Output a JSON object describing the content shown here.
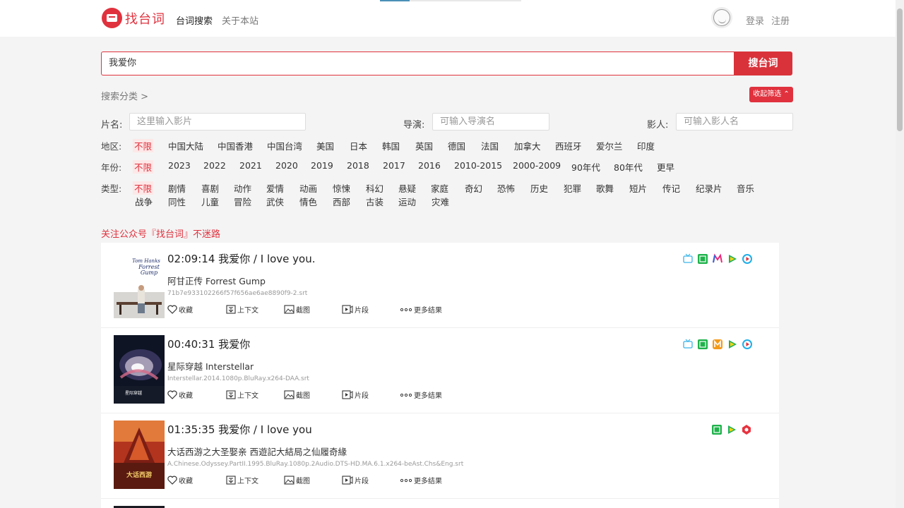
{
  "header": {
    "logo_text": "找台词",
    "nav": [
      "台词搜索",
      "关于本站"
    ],
    "login": "登录",
    "register": "注册"
  },
  "search": {
    "value": "我爱你",
    "button": "搜台词"
  },
  "filters": {
    "category_label": "搜索分类 >",
    "collapse_button": "收起筛选 ⌃",
    "film_label": "片名:",
    "film_placeholder": "这里输入影片",
    "director_label": "导演:",
    "director_placeholder": "可输入导演名",
    "actor_label": "影人:",
    "actor_placeholder": "可输入影人名",
    "region": {
      "label": "地区:",
      "options": [
        "不限",
        "中国大陆",
        "中国香港",
        "中国台湾",
        "美国",
        "日本",
        "韩国",
        "英国",
        "德国",
        "法国",
        "加拿大",
        "西班牙",
        "爱尔兰",
        "印度"
      ]
    },
    "year": {
      "label": "年份:",
      "options": [
        "不限",
        "2023",
        "2022",
        "2021",
        "2020",
        "2019",
        "2018",
        "2017",
        "2016",
        "2010-2015",
        "2000-2009",
        "90年代",
        "80年代",
        "更早"
      ]
    },
    "genre": {
      "label": "类型:",
      "row1": [
        "不限",
        "剧情",
        "喜剧",
        "动作",
        "爱情",
        "动画",
        "惊悚",
        "科幻",
        "悬疑",
        "家庭",
        "奇幻",
        "恐怖",
        "历史",
        "犯罪",
        "歌舞",
        "短片",
        "传记",
        "纪录片",
        "音乐"
      ],
      "row2": [
        "战争",
        "同性",
        "儿童",
        "冒险",
        "武侠",
        "情色",
        "西部",
        "古装",
        "运动",
        "灾难"
      ]
    }
  },
  "follow_text": "关注公众号『找台词』不迷路",
  "actions": {
    "favorite": "收藏",
    "context": "上下文",
    "screenshot": "截图",
    "clip": "片段",
    "more": "更多结果"
  },
  "results": [
    {
      "time": "02:09:14",
      "line": "我爱你 / I love you.",
      "movie": "阿甘正传 Forrest Gump",
      "file": "71b7e933102266f57f656ae6ae8890f9-2.srt",
      "poster_text": "Tom Hanks is Forrest Gump",
      "platforms": [
        "tv-icon",
        "iqiyi-icon",
        "mgtv-icon",
        "tencent-icon",
        "youku-icon"
      ]
    },
    {
      "time": "00:40:31",
      "line": "我爱你",
      "movie": "星际穿越 Interstellar",
      "file": "Interstellar.2014.1080p.BluRay.x264-DAA.srt",
      "poster_text": "星际穿越",
      "platforms": [
        "tv-icon",
        "iqiyi-icon",
        "mgtv-orange-icon",
        "tencent-icon",
        "youku-icon"
      ]
    },
    {
      "time": "01:35:35",
      "line": "我爱你 / I love you",
      "movie": "大话西游之大圣娶亲 西遊記大結局之仙履奇緣",
      "file": "A.Chinese.Odyssey.PartII.1995.BluRay.1080p.2Audio.DTS-HD.MA.6.1.x264-beAst.Chs&Eng.srt",
      "poster_text": "大话西游",
      "platforms": [
        "iqiyi-icon",
        "tencent-icon",
        "bilibili-icon"
      ]
    }
  ]
}
